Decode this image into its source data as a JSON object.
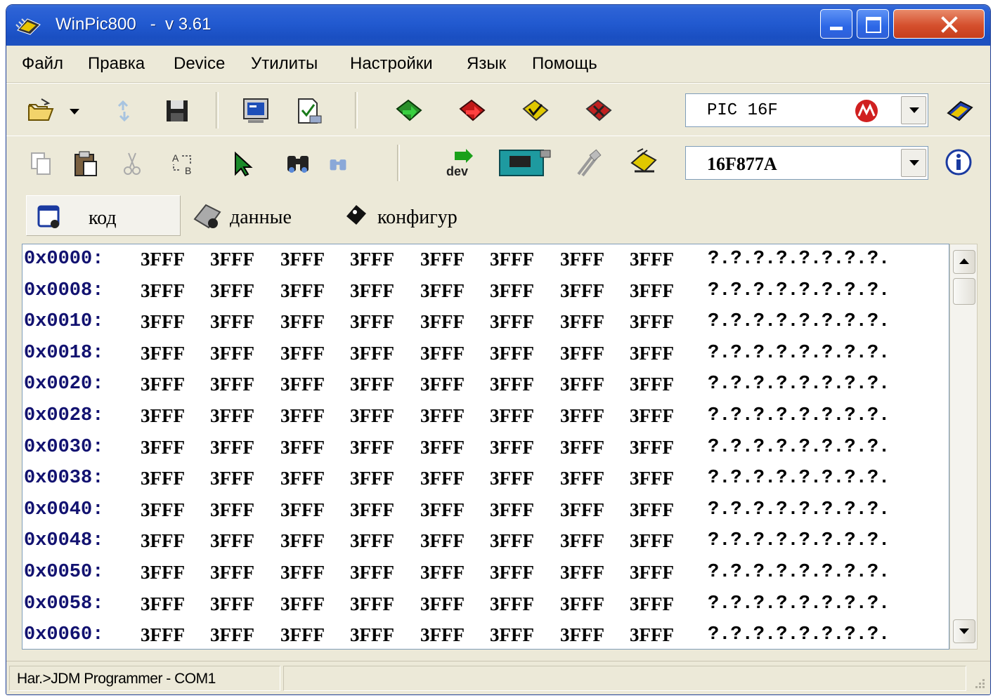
{
  "window": {
    "title": "WinPic800   -  v 3.61"
  },
  "menu": [
    "Файл",
    "Правка",
    "Device",
    "Утилиты",
    "Настройки",
    "Язык",
    "Помощь"
  ],
  "toolbar": {
    "family_select": "PIC 16F",
    "device_select": "16F877A"
  },
  "tabs": [
    {
      "label": "код",
      "active": true
    },
    {
      "label": "данные",
      "active": false
    },
    {
      "label": "конфигур",
      "active": false
    }
  ],
  "hex": {
    "rows": [
      {
        "addr": "0x0000:",
        "cells": [
          "3FFF",
          "3FFF",
          "3FFF",
          "3FFF",
          "3FFF",
          "3FFF",
          "3FFF",
          "3FFF"
        ],
        "ascii": "?.?.?.?.?.?.?.?."
      },
      {
        "addr": "0x0008:",
        "cells": [
          "3FFF",
          "3FFF",
          "3FFF",
          "3FFF",
          "3FFF",
          "3FFF",
          "3FFF",
          "3FFF"
        ],
        "ascii": "?.?.?.?.?.?.?.?."
      },
      {
        "addr": "0x0010:",
        "cells": [
          "3FFF",
          "3FFF",
          "3FFF",
          "3FFF",
          "3FFF",
          "3FFF",
          "3FFF",
          "3FFF"
        ],
        "ascii": "?.?.?.?.?.?.?.?."
      },
      {
        "addr": "0x0018:",
        "cells": [
          "3FFF",
          "3FFF",
          "3FFF",
          "3FFF",
          "3FFF",
          "3FFF",
          "3FFF",
          "3FFF"
        ],
        "ascii": "?.?.?.?.?.?.?.?."
      },
      {
        "addr": "0x0020:",
        "cells": [
          "3FFF",
          "3FFF",
          "3FFF",
          "3FFF",
          "3FFF",
          "3FFF",
          "3FFF",
          "3FFF"
        ],
        "ascii": "?.?.?.?.?.?.?.?."
      },
      {
        "addr": "0x0028:",
        "cells": [
          "3FFF",
          "3FFF",
          "3FFF",
          "3FFF",
          "3FFF",
          "3FFF",
          "3FFF",
          "3FFF"
        ],
        "ascii": "?.?.?.?.?.?.?.?."
      },
      {
        "addr": "0x0030:",
        "cells": [
          "3FFF",
          "3FFF",
          "3FFF",
          "3FFF",
          "3FFF",
          "3FFF",
          "3FFF",
          "3FFF"
        ],
        "ascii": "?.?.?.?.?.?.?.?."
      },
      {
        "addr": "0x0038:",
        "cells": [
          "3FFF",
          "3FFF",
          "3FFF",
          "3FFF",
          "3FFF",
          "3FFF",
          "3FFF",
          "3FFF"
        ],
        "ascii": "?.?.?.?.?.?.?.?."
      },
      {
        "addr": "0x0040:",
        "cells": [
          "3FFF",
          "3FFF",
          "3FFF",
          "3FFF",
          "3FFF",
          "3FFF",
          "3FFF",
          "3FFF"
        ],
        "ascii": "?.?.?.?.?.?.?.?."
      },
      {
        "addr": "0x0048:",
        "cells": [
          "3FFF",
          "3FFF",
          "3FFF",
          "3FFF",
          "3FFF",
          "3FFF",
          "3FFF",
          "3FFF"
        ],
        "ascii": "?.?.?.?.?.?.?.?."
      },
      {
        "addr": "0x0050:",
        "cells": [
          "3FFF",
          "3FFF",
          "3FFF",
          "3FFF",
          "3FFF",
          "3FFF",
          "3FFF",
          "3FFF"
        ],
        "ascii": "?.?.?.?.?.?.?.?."
      },
      {
        "addr": "0x0058:",
        "cells": [
          "3FFF",
          "3FFF",
          "3FFF",
          "3FFF",
          "3FFF",
          "3FFF",
          "3FFF",
          "3FFF"
        ],
        "ascii": "?.?.?.?.?.?.?.?."
      },
      {
        "addr": "0x0060:",
        "cells": [
          "3FFF",
          "3FFF",
          "3FFF",
          "3FFF",
          "3FFF",
          "3FFF",
          "3FFF",
          "3FFF"
        ],
        "ascii": "?.?.?.?.?.?.?.?."
      }
    ]
  },
  "statusbar": {
    "text": "Har.>JDM Programmer - COM1"
  },
  "icons": [
    "app-chip-icon",
    "open-folder-icon",
    "dropdown-arrow-icon",
    "reload-icon",
    "save-icon",
    "monitor-icon",
    "verify-icon",
    "read-all-icon",
    "write-all-icon",
    "verify-all-icon",
    "erase-all-icon",
    "microchip-logo-icon",
    "book-icon",
    "copy-icon",
    "paste-icon",
    "cut-icon",
    "replace-icon",
    "cursor-icon",
    "find-icon",
    "find-next-icon",
    "detect-device-icon",
    "hardware-icon",
    "cable-icon",
    "hardware-test-icon",
    "info-icon"
  ]
}
